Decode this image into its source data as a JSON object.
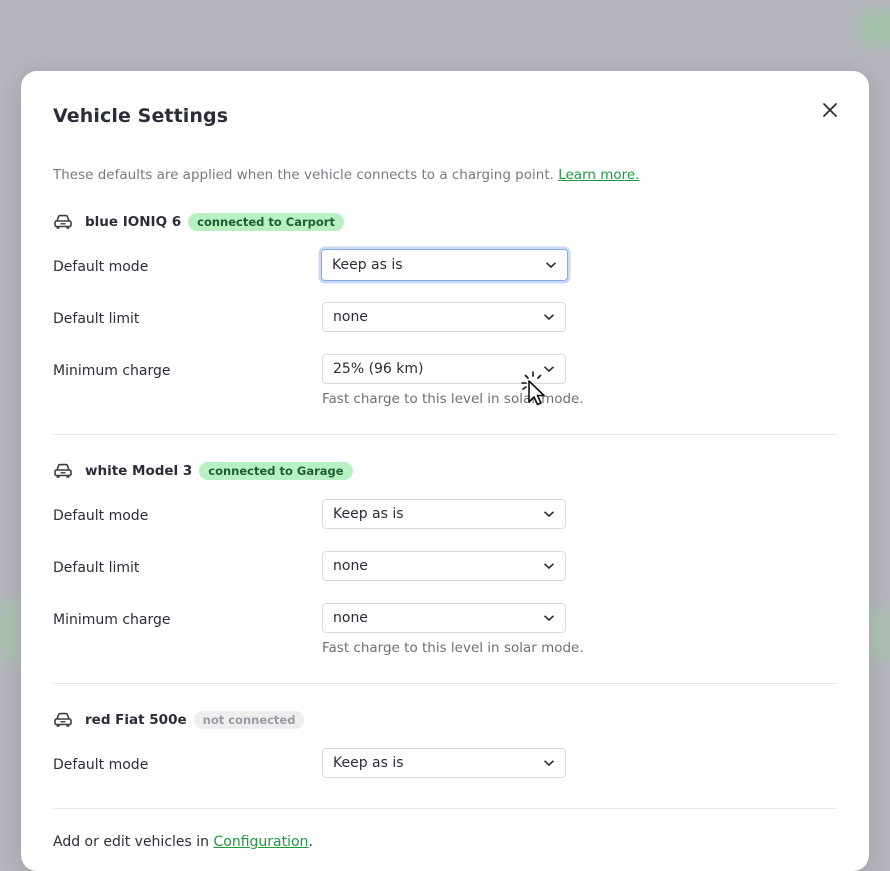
{
  "modal": {
    "title": "Vehicle Settings",
    "intro_text": "These defaults are applied when the vehicle connects to a charging point.",
    "intro_link": "Learn more.",
    "footer_text_before": "Add or edit vehicles in",
    "footer_link": "Configuration",
    "footer_text_after": "."
  },
  "labels": {
    "default_mode": "Default mode",
    "default_limit": "Default limit",
    "minimum_charge": "Minimum charge",
    "min_charge_hint_v1": "Fast charge to this level in sol",
    "min_charge_hint_v1_tail": "ar mode.",
    "min_charge_hint": "Fast charge to this level in solar mode."
  },
  "vehicles": [
    {
      "name": "blue IONIQ 6",
      "status": "connected to Carport",
      "default_mode": "Keep as is",
      "default_limit": "none",
      "minimum_charge": "25% (96 km)"
    },
    {
      "name": "white Model 3",
      "status": "connected to Garage",
      "default_mode": "Keep as is",
      "default_limit": "none",
      "minimum_charge": "none"
    },
    {
      "name": "red Fiat 500e",
      "status": "not connected",
      "default_mode": "Keep as is"
    }
  ],
  "colors": {
    "link": "#1f9a3f",
    "badge_connected_bg": "#b8f0c4",
    "badge_disconnected_bg": "#eeeeef",
    "focus_ring": "#86a9e8"
  }
}
